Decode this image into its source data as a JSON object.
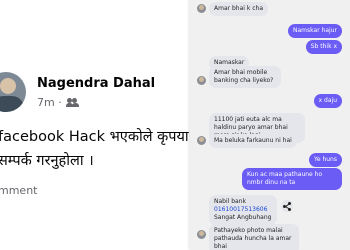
{
  "post": {
    "author": "Nagendra Dahal",
    "time": "7m ·",
    "line1": "facebook Hack भएकोले कृपया",
    "line2": "सम्पर्क गरनुहोला ।",
    "action": "mment"
  },
  "chat": {
    "messages": [
      {
        "side": "in",
        "text": "Amar bhai k cha"
      },
      {
        "side": "out",
        "text": "Namskar hajur"
      },
      {
        "side": "out",
        "text": "Sb thik x"
      },
      {
        "side": "in",
        "text": "Namaskar"
      },
      {
        "side": "in",
        "text": "Amar bhai mobile banking cha liyeko?"
      },
      {
        "side": "out",
        "text": "x daju"
      },
      {
        "side": "in",
        "text": "11100 jati euta alc ma haldinu paryo amar bhai mero sir ko lagi"
      },
      {
        "side": "in",
        "text": "Ma beluka farkaunu ni hai"
      },
      {
        "side": "out",
        "text": "Ye huns"
      },
      {
        "side": "out",
        "text": "Kun ac maa pathaune ho nmbr dinu na ta"
      },
      {
        "side": "in",
        "text": "Nabil bank"
      },
      {
        "side": "in",
        "text": "01610017513606"
      },
      {
        "side": "in",
        "text": "Sangat Angbuhang"
      },
      {
        "side": "in",
        "text": "Pathayeko photo malai pathauda huncha la amar bhai"
      }
    ]
  },
  "colors": {
    "outgoing": "#6a5cf5",
    "incoming": "#e4e6eb",
    "link": "#1a47d6"
  }
}
